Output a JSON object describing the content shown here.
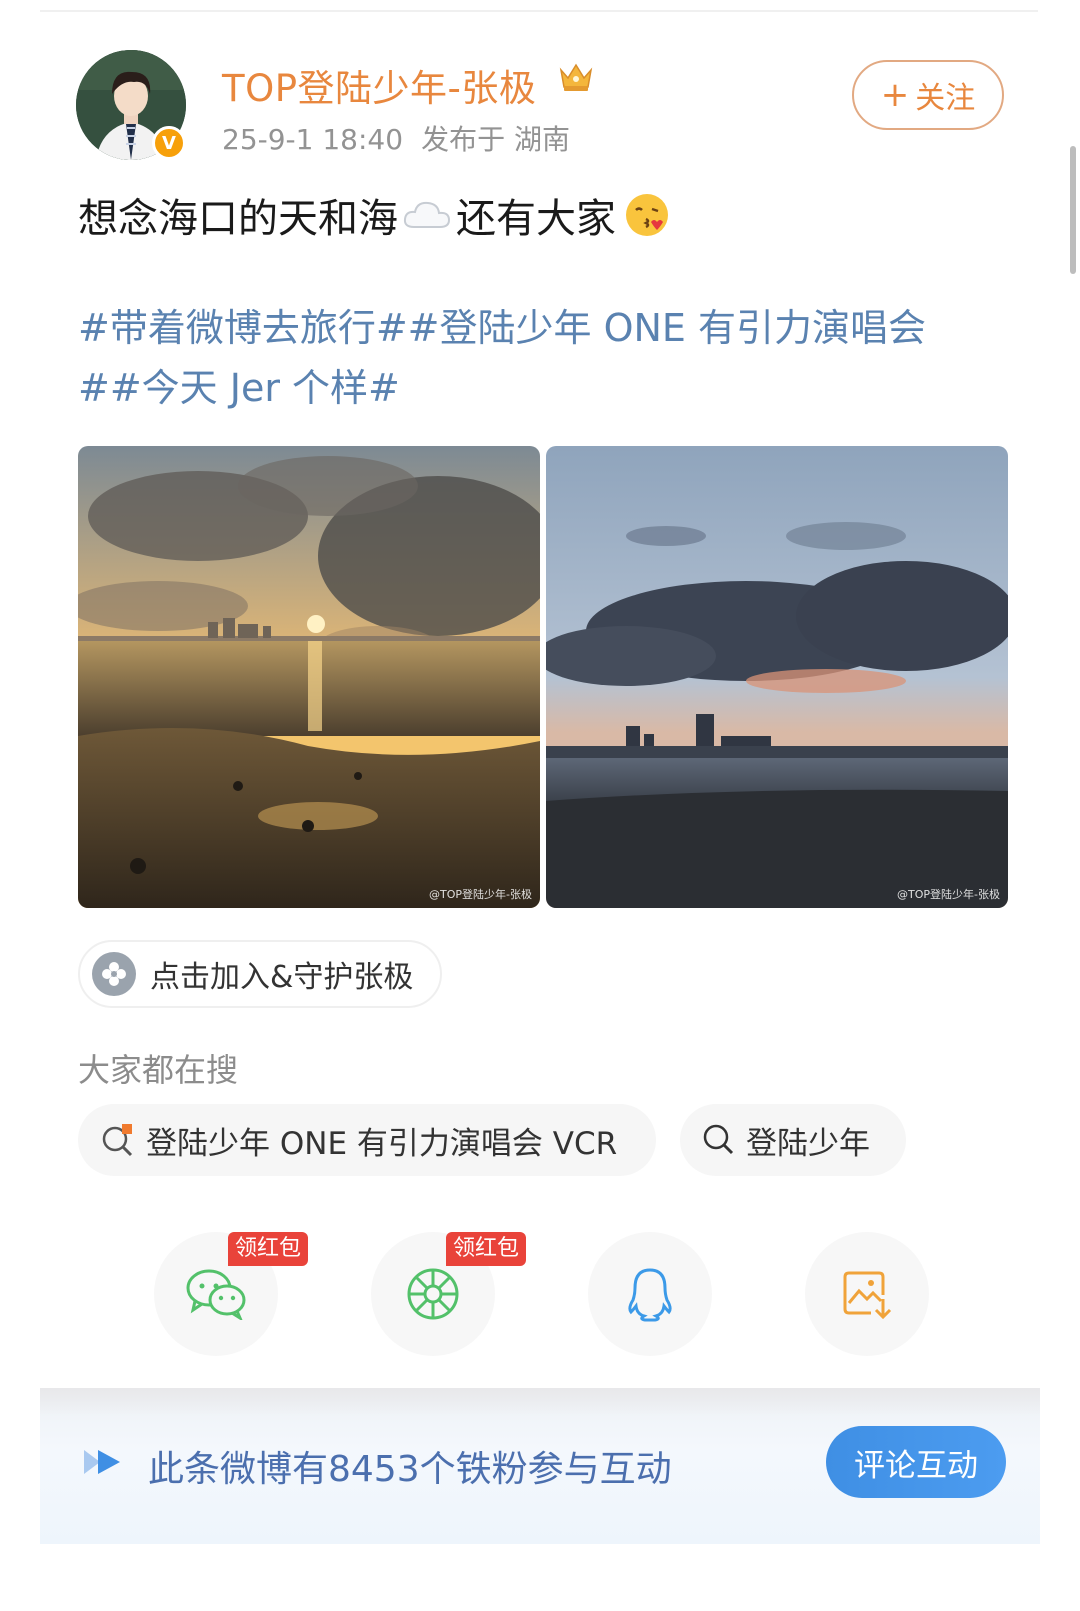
{
  "author": {
    "name": "TOP登陆少年-张极",
    "verified_badge": "V",
    "avatar_icon": "avatar-image",
    "crown_icon": "crown-icon"
  },
  "post_meta": {
    "time": "25-9-1 18:40",
    "location": "发布于 湖南"
  },
  "follow_button": {
    "plus": "+",
    "label": "关注"
  },
  "post": {
    "text_part1": "想念海口的天和海",
    "text_part2": "还有大家",
    "emoji_1": "cloud-emoji",
    "emoji_2": "kiss-emoji",
    "tags_line1": "#带着微博去旅行##登陆少年 ONE 有引力演唱会",
    "tags_line2": "##今天 Jer 个样#"
  },
  "photos": [
    {
      "subject": "sunset-over-beach",
      "watermark": "@TOP登陆少年-张极"
    },
    {
      "subject": "cloudy-dusk-skyline",
      "watermark": "@TOP登陆少年-张极"
    }
  ],
  "join_chip": {
    "icon": "flower-icon",
    "label": "点击加入&守护张极"
  },
  "search_section": {
    "title": "大家都在搜",
    "chips": [
      {
        "icon": "hot-search-icon",
        "label": "登陆少年 ONE 有引力演唱会 VCR"
      },
      {
        "icon": "search-icon",
        "label": "登陆少年"
      }
    ]
  },
  "share": {
    "items": [
      {
        "icon": "wechat-icon",
        "badge": "领红包",
        "color": "#53c16a"
      },
      {
        "icon": "moments-icon",
        "badge": "领红包",
        "color": "#53c16a"
      },
      {
        "icon": "qq-icon",
        "color": "#3c9ae8"
      },
      {
        "icon": "save-image-icon",
        "color": "#f0a33a"
      }
    ]
  },
  "fan_banner": {
    "text": "此条微博有8453个铁粉参与互动",
    "button": "评论互动"
  },
  "colors": {
    "username": "#e8873e",
    "tag_link": "#5a82b0",
    "accent_blue": "#3f8fe4",
    "badge_red": "#e9433a"
  }
}
